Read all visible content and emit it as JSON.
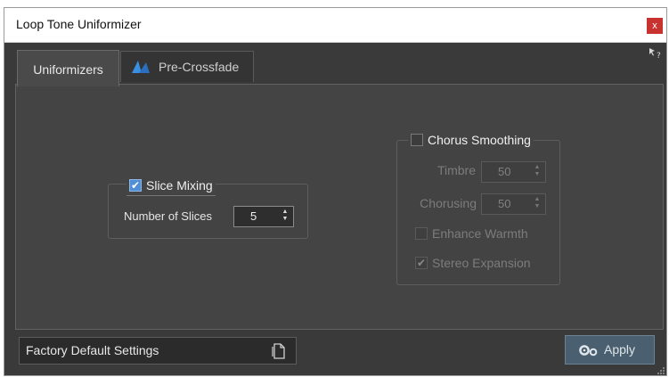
{
  "window": {
    "title": "Loop Tone Uniformizer",
    "close_label": "x"
  },
  "tabs": [
    {
      "label": "Uniformizers",
      "selected": true
    },
    {
      "label": "Pre-Crossfade",
      "selected": false
    }
  ],
  "slice_mixing": {
    "label": "Slice Mixing",
    "checked": true,
    "slices_label": "Number of Slices",
    "slices_value": "5"
  },
  "chorus_smoothing": {
    "label": "Chorus Smoothing",
    "checked": false,
    "timbre_label": "Timbre",
    "timbre_value": "50",
    "chorusing_label": "Chorusing",
    "chorusing_value": "50",
    "enhance_warmth_label": "Enhance Warmth",
    "enhance_warmth_checked": false,
    "stereo_expansion_label": "Stereo Expansion",
    "stereo_expansion_checked": true
  },
  "footer": {
    "preset_label": "Factory Default Settings",
    "apply_label": "Apply"
  },
  "icons": {
    "help": "help-pointer-icon",
    "tab": "crossfade-triangles-icon",
    "preset": "preset-document-icon",
    "apply": "gears-icon"
  },
  "colors": {
    "panel": "#444444",
    "checkbox_checked": "#4f8fd6",
    "close": "#c8332f",
    "apply": "#4a6070"
  }
}
